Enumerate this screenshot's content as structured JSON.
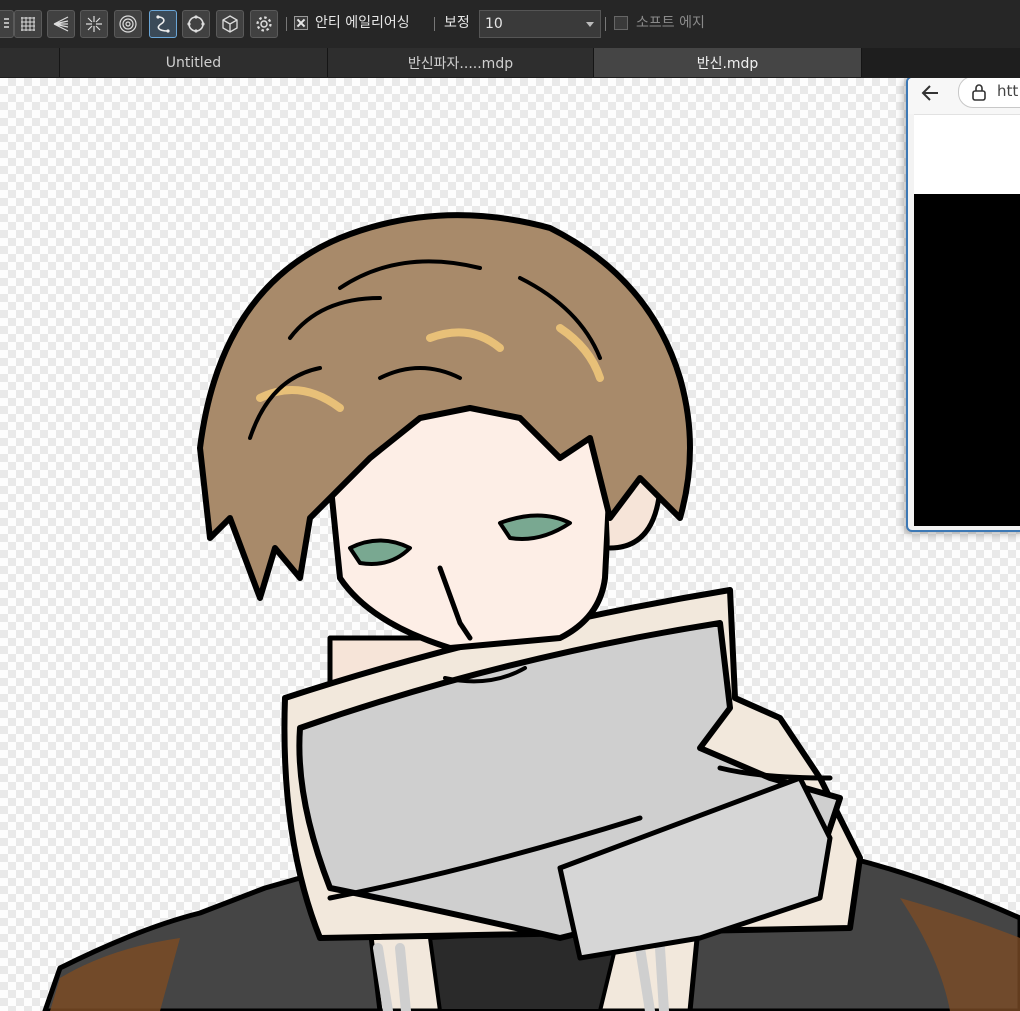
{
  "toolbar": {
    "tools": [
      {
        "icon": "menu-lines-icon"
      },
      {
        "icon": "grid-icon"
      },
      {
        "icon": "perspective-icon"
      },
      {
        "icon": "radial-lines-icon"
      },
      {
        "icon": "concentric-circles-icon"
      },
      {
        "icon": "curve-ruler-icon",
        "active": true
      },
      {
        "icon": "circle-ruler-icon"
      },
      {
        "icon": "cube-icon"
      },
      {
        "icon": "gear-icon"
      }
    ],
    "antialias_label": "안티 에일리어싱",
    "antialias_checked": true,
    "correction_label": "보정",
    "correction_value": "10",
    "soft_edge_label": "소프트 에지",
    "soft_edge_checked": false
  },
  "tabs": [
    {
      "label": "Untitled",
      "active": false
    },
    {
      "label": "반신파자.....mdp",
      "active": false
    },
    {
      "label": "반신.mdp",
      "active": true
    }
  ],
  "browser": {
    "url": "htt",
    "back_icon": "back-arrow-icon",
    "lock_icon": "lock-icon"
  },
  "colors": {
    "toolbar_bg": "#262626",
    "active_tab": "#454545",
    "hair": "#a88a6a",
    "hair_highlight": "#e8c078",
    "skin": "#fdeee6",
    "jacket": "#454545",
    "jacket_brown": "#7a4b25",
    "scarf": "#cfcfcf",
    "hood_cream": "#f2e8dc",
    "eye": "#79a891",
    "browser_border": "#3c78b5"
  }
}
